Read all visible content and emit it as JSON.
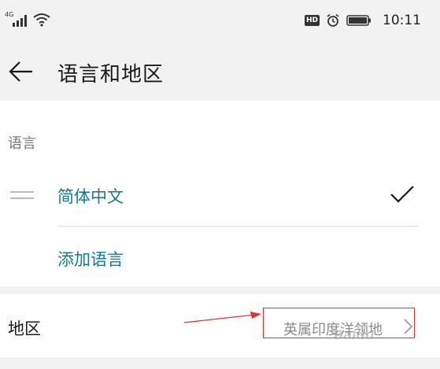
{
  "status_bar": {
    "network": "4G",
    "hd": "HD",
    "time": "10:11",
    "icons": [
      "signal-icon",
      "wifi-icon",
      "alarm-icon",
      "battery-icon"
    ]
  },
  "header": {
    "back_icon": "arrow-left-icon",
    "title": "语言和地区"
  },
  "language_section": {
    "label": "语言",
    "items": [
      {
        "name": "简体中文",
        "selected": true
      }
    ],
    "add_label": "添加语言"
  },
  "region": {
    "label": "地区",
    "value": "英属印度洋领地"
  },
  "watermark": "Baidu",
  "colors": {
    "accent": "#127a8a",
    "annotation": "#e53030",
    "background": "#f2f2f2",
    "card": "#ffffff"
  }
}
